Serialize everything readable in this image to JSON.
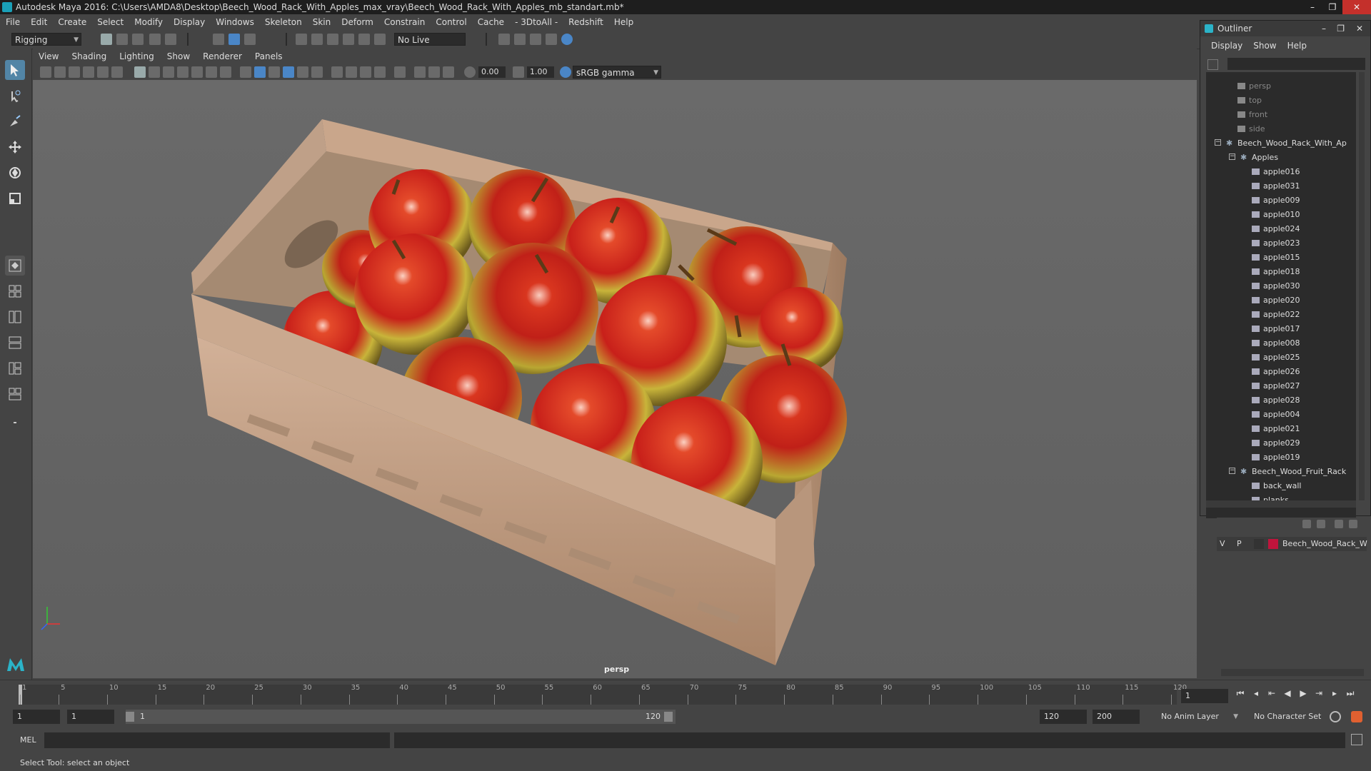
{
  "window": {
    "title": "Autodesk Maya 2016: C:\\Users\\AMDA8\\Desktop\\Beech_Wood_Rack_With_Apples_max_vray\\Beech_Wood_Rack_With_Apples_mb_standart.mb*",
    "minimize": "–",
    "restore": "❐",
    "close": "✕"
  },
  "menu": [
    "File",
    "Edit",
    "Create",
    "Select",
    "Modify",
    "Display",
    "Windows",
    "Skeleton",
    "Skin",
    "Deform",
    "Constrain",
    "Control",
    "Cache",
    "- 3DtoAll -",
    "Redshift",
    "Help"
  ],
  "shelf": {
    "menuset": "Rigging",
    "live_surface": "No Live Surface"
  },
  "viewport": {
    "menu": [
      "View",
      "Shading",
      "Lighting",
      "Show",
      "Renderer",
      "Panels"
    ],
    "exposure": "0.00",
    "gamma": "1.00",
    "colorspace": "sRGB gamma",
    "camera": "persp"
  },
  "outliner": {
    "title": "Outliner",
    "menu": [
      "Display",
      "Show",
      "Help"
    ],
    "cameras": [
      "persp",
      "top",
      "front",
      "side"
    ],
    "root": "Beech_Wood_Rack_With_Ap",
    "apples_group": "Apples",
    "apples": [
      "apple016",
      "apple031",
      "apple009",
      "apple010",
      "apple024",
      "apple023",
      "apple015",
      "apple018",
      "apple030",
      "apple020",
      "apple022",
      "apple017",
      "apple008",
      "apple025",
      "apple026",
      "apple027",
      "apple028",
      "apple004",
      "apple021",
      "apple029",
      "apple019"
    ],
    "rack_group": "Beech_Wood_Fruit_Rack",
    "rack_items": [
      "back_wall",
      "planks"
    ]
  },
  "layers": {
    "v": "V",
    "p": "P",
    "name": "Beech_Wood_Rack_W",
    "color": "#c0143c"
  },
  "timeline": {
    "ticks": [
      "1",
      "5",
      "10",
      "15",
      "20",
      "25",
      "30",
      "35",
      "40",
      "45",
      "50",
      "55",
      "60",
      "65",
      "70",
      "75",
      "80",
      "85",
      "90",
      "95",
      "100",
      "105",
      "110",
      "115",
      "120"
    ],
    "current_frame": "1"
  },
  "range": {
    "start": "1",
    "anim_start": "1",
    "range_start": "1",
    "range_end": "120",
    "end": "120",
    "anim_end": "200",
    "anim_layer": "No Anim Layer",
    "char_set": "No Character Set"
  },
  "cmd": {
    "lang": "MEL"
  },
  "help_line": "Select Tool: select an object",
  "colors": {
    "accent": "#5285a6",
    "apple_red": "#c8201a",
    "apple_yellow": "#c8b43a",
    "wood": "#c4a285"
  }
}
